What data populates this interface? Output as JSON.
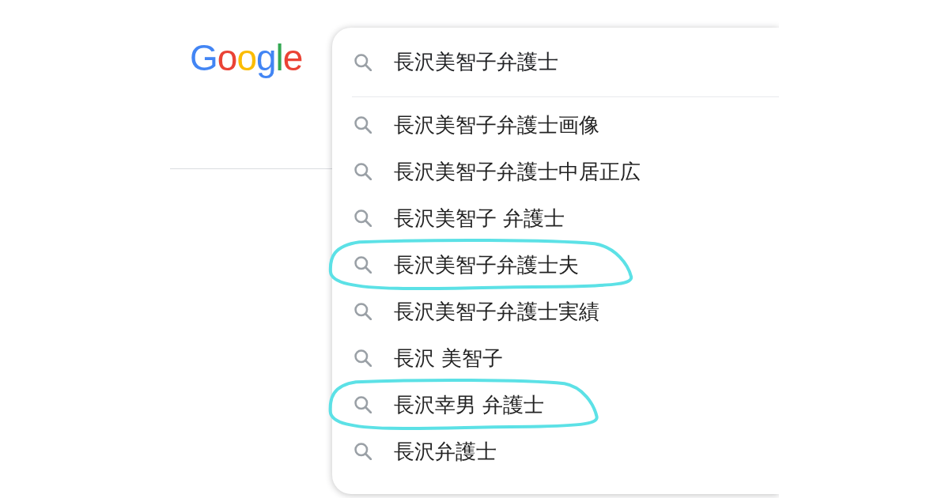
{
  "logo": {
    "text": "Google"
  },
  "search": {
    "value": "長沢美智子弁護士"
  },
  "suggestions": [
    {
      "text": "長沢美智子弁護士画像",
      "circled": false
    },
    {
      "text": "長沢美智子弁護士中居正広",
      "circled": false
    },
    {
      "text": "長沢美智子 弁護士",
      "circled": false
    },
    {
      "text": "長沢美智子弁護士夫",
      "circled": true
    },
    {
      "text": "長沢美智子弁護士実績",
      "circled": false
    },
    {
      "text": "長沢 美智子",
      "circled": false
    },
    {
      "text": "長沢幸男 弁護士",
      "circled": true
    },
    {
      "text": "長沢弁護士",
      "circled": false
    }
  ]
}
